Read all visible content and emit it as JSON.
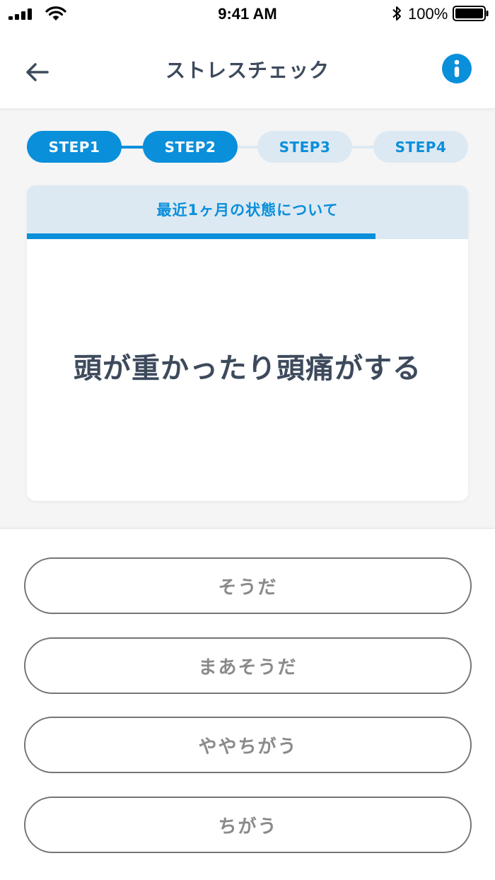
{
  "status_bar": {
    "time": "9:41 AM",
    "battery": "100%",
    "icons": [
      "signal-icon",
      "wifi-icon",
      "bluetooth-icon",
      "battery-icon"
    ]
  },
  "header": {
    "title": "ストレスチェック",
    "back_icon": "arrow-left-icon",
    "info_icon": "info-icon"
  },
  "steps": [
    {
      "label": "STEP1",
      "state": "active"
    },
    {
      "label": "STEP2",
      "state": "active"
    },
    {
      "label": "STEP3",
      "state": "inactive"
    },
    {
      "label": "STEP4",
      "state": "inactive"
    }
  ],
  "card": {
    "section_title": "最近1ヶ月の状態について",
    "progress": 0.79,
    "question": "頭が重かったり頭痛がする"
  },
  "answers": [
    "そうだ",
    "まあそうだ",
    "ややちがう",
    "ちがう"
  ],
  "colors": {
    "accent": "#0a8fdb",
    "accent_light": "#dde9f2",
    "text_dark": "#3d4a5c",
    "answer_text": "#8a8a8a",
    "answer_border": "#757575",
    "background": "#f5f5f5"
  }
}
